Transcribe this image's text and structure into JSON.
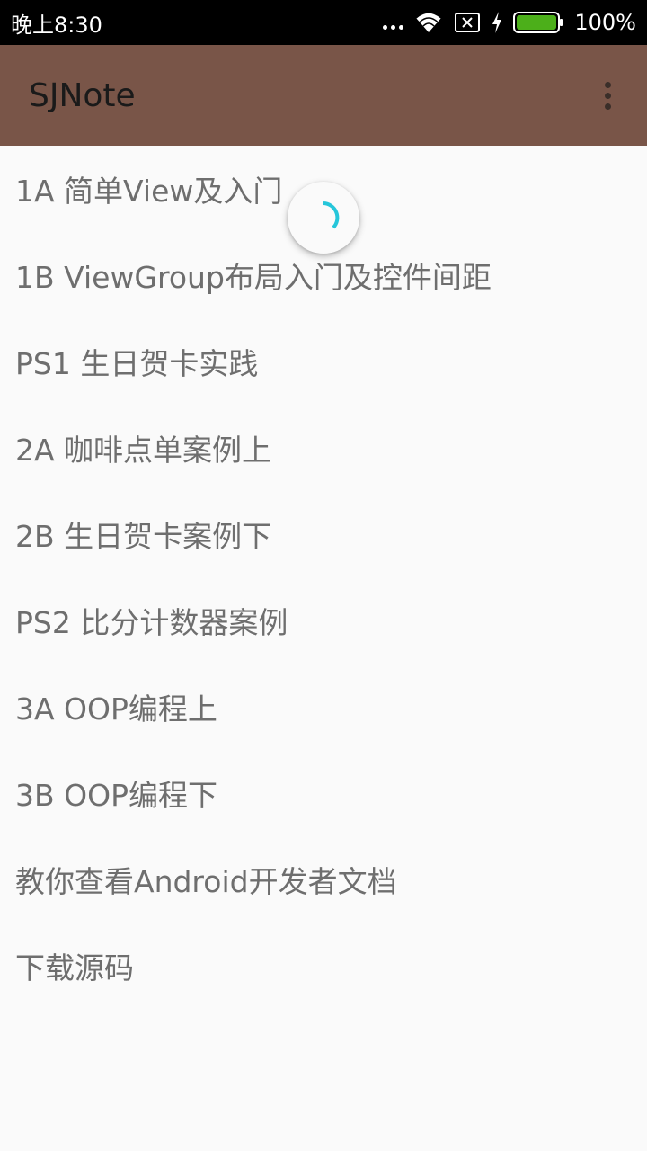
{
  "status_bar": {
    "time": "晚上8:30",
    "battery_percent": "100%",
    "icons": [
      "more-dots-icon",
      "wifi-icon",
      "sim-card-icon",
      "charging-bolt-icon",
      "battery-icon"
    ]
  },
  "app_bar": {
    "title": "SJNote",
    "menu_icon": "overflow-menu-icon",
    "color": "#795548"
  },
  "list": {
    "items": [
      {
        "label": "1A 简单View及入门"
      },
      {
        "label": "1B ViewGroup布局入门及控件间距"
      },
      {
        "label": "PS1 生日贺卡实践"
      },
      {
        "label": "2A 咖啡点单案例上"
      },
      {
        "label": "2B 生日贺卡案例下"
      },
      {
        "label": "PS2 比分计数器案例"
      },
      {
        "label": "3A OOP编程上"
      },
      {
        "label": "3B OOP编程下"
      },
      {
        "label": "教你查看Android开发者文档"
      },
      {
        "label": "下载源码"
      }
    ]
  },
  "refresh_indicator": {
    "icon": "loading-spinner-icon",
    "color": "#26c6da"
  }
}
